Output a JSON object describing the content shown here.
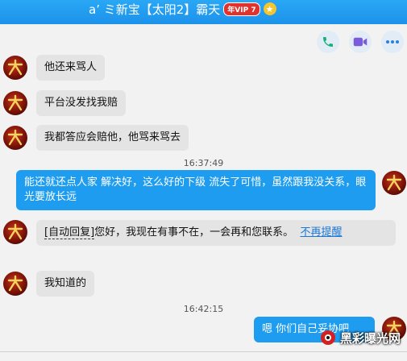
{
  "header": {
    "title": "a’ ミ新宝【太阳2】霸天",
    "vip_badge": "年VIP 7",
    "crown_icon": "crown-icon"
  },
  "toolbar": {
    "phone_icon": "phone-icon",
    "video_icon": "video-icon",
    "more_icon": "more-icon"
  },
  "messages": [
    {
      "side": "in",
      "text": "他还来骂人"
    },
    {
      "side": "in",
      "text": "平台没发找我赔"
    },
    {
      "side": "in",
      "text": "我都答应会赔他，他骂来骂去"
    },
    {
      "side": "time",
      "text": "16:37:49"
    },
    {
      "side": "out",
      "text": "能还就还点人家  解决好，这么好的下级  流失了可惜，虽然跟我没关系，眼光要放长远"
    },
    {
      "side": "in",
      "auto_tag": "[自动回复]",
      "text": "您好，我现在有事不在，一会再和您联系。",
      "link": "不再提醒"
    },
    {
      "side": "in",
      "text": "我知道的"
    },
    {
      "side": "time",
      "text": "16:42:15"
    },
    {
      "side": "out",
      "text": "嗯  你们自己妥协吧"
    }
  ],
  "watermark": {
    "text": "黑彩曝光网"
  },
  "colors": {
    "titlebar": "#1c92ea",
    "out_bubble": "#1e9cf0",
    "in_bubble": "#e4e4e4",
    "vip_badge": "#e0332e",
    "link": "#1a78d8"
  }
}
